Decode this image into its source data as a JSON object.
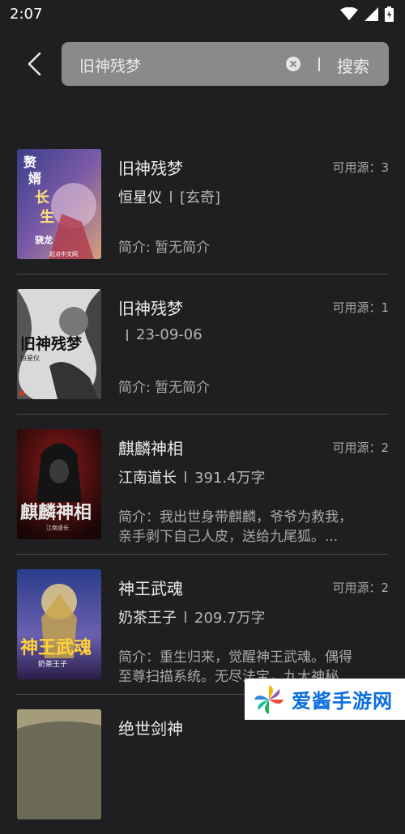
{
  "status": {
    "time": "2:07"
  },
  "search": {
    "query": "旧神残梦",
    "button": "搜索"
  },
  "results": [
    {
      "title": "旧神残梦",
      "author": "恒星仪",
      "tag": "[玄奇]",
      "source": "可用源：3",
      "intro": "简介: 暂无简介",
      "cover_text": [
        "赘",
        "婿",
        "长",
        "生",
        "骁龙",
        "起点中文网"
      ]
    },
    {
      "title": "旧神残梦",
      "author": "",
      "tag": "23-09-06",
      "source": "可用源：1",
      "intro": "简介: 暂无简介",
      "cover_text": [
        "旧神残梦",
        "恒星仪"
      ]
    },
    {
      "title": "麒麟神相",
      "author": "江南道长",
      "tag": "391.4万字",
      "source": "可用源：2",
      "intro": [
        "简介：我出世身带麒麟，爷爷为救我，",
        "亲手剥下自己人皮，送给九尾狐。..."
      ],
      "cover_text": [
        "麒麟神相",
        "江南道长"
      ]
    },
    {
      "title": "神王武魂",
      "author": "奶茶王子",
      "tag": "209.7万字",
      "source": "可用源：2",
      "intro": [
        "简介：重生归来，觉醒神王武魂。偶得",
        "至尊扫描系统。无尽法宝，九大神秘..."
      ],
      "cover_text": [
        "神王武魂",
        "奶茶王子"
      ]
    },
    {
      "title": "绝世剑神"
    }
  ],
  "watermark": {
    "text": "爱酱手游网"
  },
  "colors": {
    "background": "#1f1f21",
    "searchbox": "#8a8a8a",
    "wm_blue": "#0b6ee0"
  }
}
